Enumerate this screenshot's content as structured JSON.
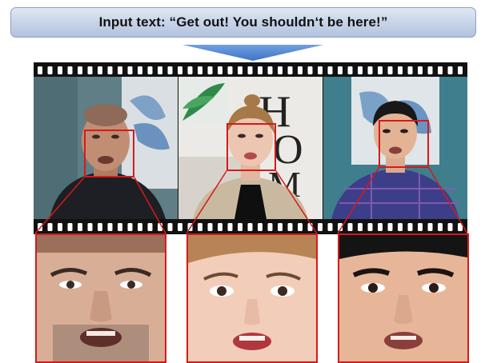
{
  "banner": {
    "text": "Input text: “Get out! You shouldn‘t be here!”"
  },
  "colors": {
    "banner_fill": "#c5d2e7",
    "arrow": "#5b8fd6",
    "highlight_box": "#d51a1a",
    "film": "#111111",
    "perforation": "#ffffff"
  },
  "frames": [
    {
      "id": "speaker-1",
      "description_icon": "bald-man-portrait"
    },
    {
      "id": "speaker-2",
      "description_icon": "woman-portrait",
      "wall_letters": "HOME"
    },
    {
      "id": "speaker-3",
      "description_icon": "young-man-portrait"
    }
  ]
}
